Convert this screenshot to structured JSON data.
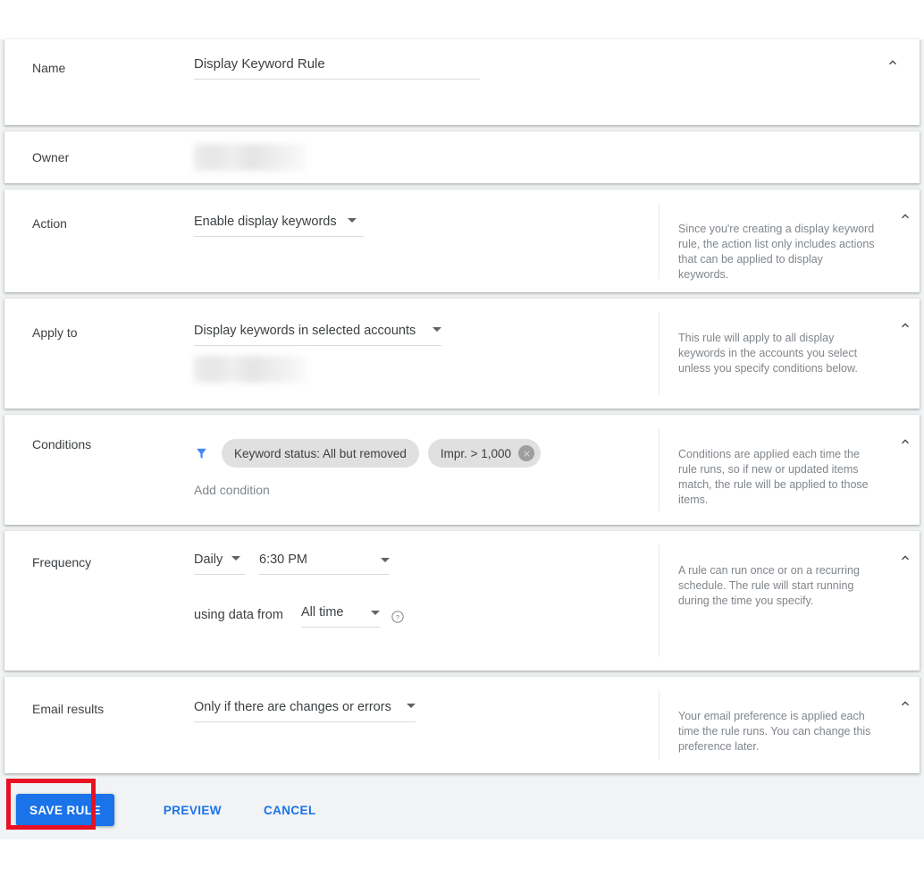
{
  "rows": {
    "name": {
      "label": "Name",
      "value": "Display Keyword Rule"
    },
    "owner": {
      "label": "Owner",
      "value": ""
    },
    "action": {
      "label": "Action",
      "value": "Enable display keywords",
      "help": "Since you're creating a display keyword rule, the action list only includes actions that can be applied to display keywords."
    },
    "apply_to": {
      "label": "Apply to",
      "value": "Display keywords in selected accounts",
      "account_value": "",
      "help": "This rule will apply to all display keywords in the accounts you select unless you specify conditions below."
    },
    "conditions": {
      "label": "Conditions",
      "chips": [
        {
          "text": "Keyword status: All but removed",
          "removable": false
        },
        {
          "text": "Impr. > 1,000",
          "removable": true
        }
      ],
      "add_label": "Add condition",
      "help": "Conditions are applied each time the rule runs, so if new or updated items match, the rule will be applied to those items."
    },
    "frequency": {
      "label": "Frequency",
      "interval": "Daily",
      "time": "6:30 PM",
      "using_data_from_label": "using data from",
      "data_range": "All time",
      "help": "A rule can run once or on a recurring schedule. The rule will start running during the time you specify."
    },
    "email_results": {
      "label": "Email results",
      "value": "Only if there are changes or errors",
      "help": "Your email preference is applied each time the rule runs. You can change this preference later."
    }
  },
  "footer": {
    "save_label": "SAVE RULE",
    "preview_label": "PREVIEW",
    "cancel_label": "CANCEL"
  },
  "icons": {
    "collapse": "chevron-up-icon",
    "filter": "filter-icon",
    "chip_remove": "close-circle-icon",
    "help": "help-circle-icon",
    "dropdown": "caret-down-icon"
  },
  "colors": {
    "accent": "#1a73e8",
    "highlight": "#e81123",
    "page_bg": "#f1f3f4",
    "chip_bg": "#e0e0e0",
    "help_text": "#80868b"
  }
}
